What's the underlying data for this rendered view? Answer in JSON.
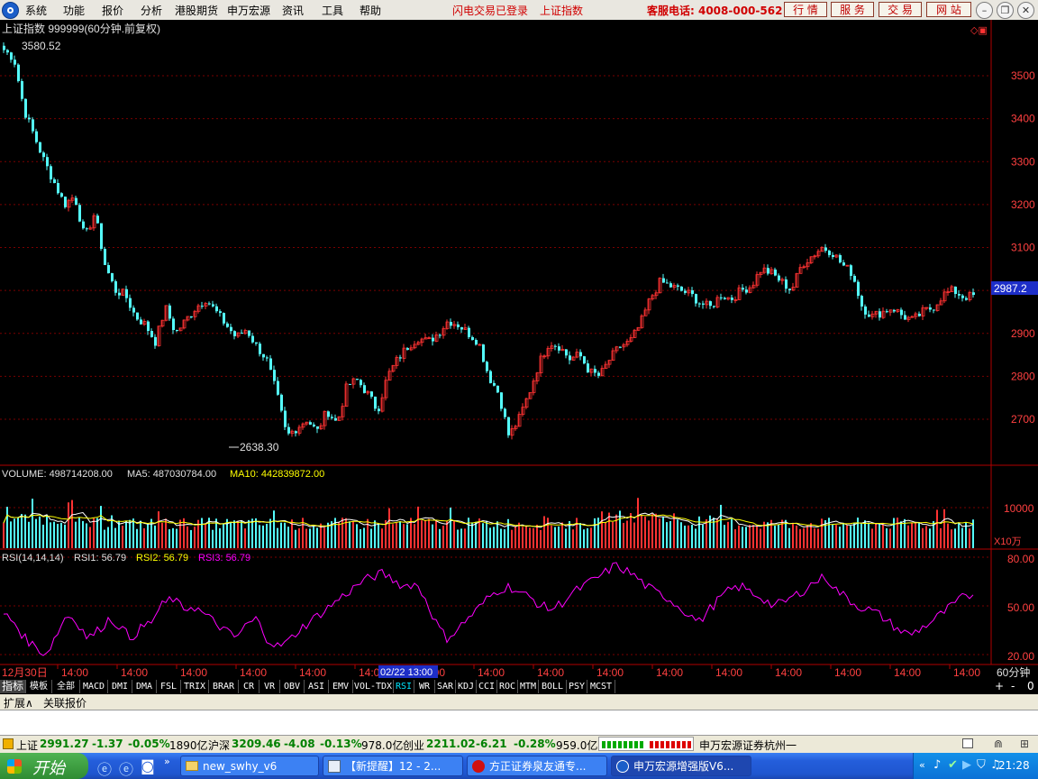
{
  "menu": {
    "items": [
      "系统",
      "功能",
      "报价",
      "分析",
      "港股期货",
      "申万宏源",
      "资讯",
      "工具",
      "帮助"
    ],
    "notice_login": "闪电交易已登录",
    "notice_index": "上证指数",
    "hotline": "客服电话: 4008-000-562",
    "buttons": [
      "行 情",
      "服 务",
      "交 易",
      "网 站"
    ]
  },
  "main_chart": {
    "title": "上证指数 999999(60分钟.前复权)",
    "high_label": "3580.52",
    "low_label": "2638.30",
    "current_price": "2987.2",
    "y_ticks": [
      "3500",
      "3400",
      "3300",
      "3200",
      "3100",
      "3000",
      "2900",
      "2800",
      "2700"
    ]
  },
  "volume_panel": {
    "title": "VOLUME: 498714208.00",
    "ma5": "MA5: 487030784.00",
    "ma10": "MA10: 442839872.00",
    "y_tick": "10000",
    "unit": "X10万"
  },
  "rsi_panel": {
    "title": "RSI(14,14,14)",
    "rsi1": "RSI1: 56.79",
    "rsi2": "RSI2: 56.79",
    "rsi3": "RSI3: 56.79",
    "y_ticks": [
      "80.00",
      "50.00",
      "20.00"
    ]
  },
  "time_axis": {
    "first_label": "12月30日",
    "labels": [
      "14:00",
      "14:00",
      "14:00",
      "14:00",
      "14:00",
      "14:00",
      "14:00",
      "14:00",
      "14:00",
      "14:00",
      "14:00",
      "14:00",
      "14:00",
      "14:00",
      "14:00",
      "14:00"
    ],
    "cursor_label": "02/22 13:00",
    "period": "60分钟"
  },
  "indicator_tabs": [
    "指标",
    "模板",
    "全部",
    "MACD",
    "DMI",
    "DMA",
    "FSL",
    "TRIX",
    "BRAR",
    "CR",
    "VR",
    "OBV",
    "ASI",
    "EMV",
    "VOL-TDX",
    "RSI",
    "WR",
    "SAR",
    "KDJ",
    "CCI",
    "ROC",
    "MTM",
    "BOLL",
    "PSY",
    "MCST"
  ],
  "indicator_active": "RSI",
  "tab_controls": [
    "+",
    "-",
    "0"
  ],
  "sub_tabs": [
    "扩展∧",
    "关联报价"
  ],
  "status": {
    "sh_label": "上证",
    "sh_value": "2991.27",
    "sh_change": "-1.37",
    "sh_pct": "-0.05%",
    "sh_amount": "1890亿",
    "hs_label": "沪深",
    "hs_value": "3209.46",
    "hs_change": "-4.08",
    "hs_pct": "-0.13%",
    "hs_amount": "978.0亿",
    "cy_label": "创业",
    "cy_value": "2211.02",
    "cy_change": "-6.21",
    "cy_pct": "-0.28%",
    "cy_amount": "959.0亿",
    "broker": "申万宏源证券杭州一"
  },
  "taskbar": {
    "start": "开始",
    "tasks": [
      "new_swhy_v6",
      "【新提醒】12 - 2...",
      "方正证券泉友通专...",
      "申万宏源增强版V6..."
    ],
    "clock": "21:28"
  },
  "colors": {
    "up": "#ff3232",
    "down": "#54fcfc",
    "ma5": "#ffffff",
    "ma10": "#ffff00",
    "rsi": "#ff00ff",
    "grid": "#7a0000",
    "axis": "#b00000"
  },
  "chart_data": [
    {
      "type": "candlestick",
      "title": "上证指数 999999(60分钟.前复权)",
      "ylim": [
        2620,
        3600
      ],
      "annotations": {
        "high": 3580.52,
        "low": 2638.3,
        "last": 2987.2
      },
      "close_path": [
        3560,
        3540,
        3420,
        3360,
        3300,
        3250,
        3200,
        3220,
        3120,
        3180,
        3060,
        3000,
        2990,
        2940,
        2920,
        2880,
        2960,
        2900,
        2930,
        2960,
        2980,
        2950,
        2920,
        2890,
        2910,
        2870,
        2840,
        2760,
        2660,
        2680,
        2700,
        2670,
        2720,
        2690,
        2780,
        2790,
        2760,
        2720,
        2800,
        2840,
        2870,
        2890,
        2880,
        2900,
        2930,
        2920,
        2900,
        2880,
        2800,
        2760,
        2660,
        2700,
        2760,
        2830,
        2880,
        2870,
        2840,
        2850,
        2810,
        2800,
        2840,
        2870,
        2880,
        2920,
        2980,
        3020,
        3010,
        3000,
        2990,
        2970,
        2960,
        2990,
        2980,
        3000,
        3010,
        3050,
        3040,
        3020,
        3000,
        3060,
        3080,
        3100,
        3090,
        3060,
        3040,
        2960,
        2940,
        2950,
        2960,
        2940,
        2930,
        2950,
        2960,
        2990,
        3000,
        2985,
        2987
      ]
    },
    {
      "type": "bar",
      "title": "VOLUME",
      "series": [
        {
          "name": "VOLUME",
          "last": 498714208
        },
        {
          "name": "MA5",
          "last": 487030784
        },
        {
          "name": "MA10",
          "last": 442839872
        }
      ]
    },
    {
      "type": "line",
      "title": "RSI(14,14,14)",
      "ylim": [
        15,
        85
      ],
      "series": [
        {
          "name": "RSI1",
          "values": [
            45,
            40,
            30,
            25,
            20,
            32,
            45,
            40,
            30,
            35,
            42,
            38,
            30,
            36,
            40,
            50,
            55,
            48,
            50,
            45,
            40,
            35,
            30,
            38,
            42,
            30,
            25,
            28,
            35,
            40,
            45,
            50,
            55,
            60,
            65,
            68,
            70,
            66,
            62,
            64,
            55,
            40,
            30,
            35,
            42,
            48,
            55,
            60,
            62,
            58,
            55,
            50,
            48,
            52,
            58,
            62,
            66,
            70,
            75,
            72,
            68,
            62,
            58,
            55,
            50,
            45,
            40,
            48,
            55,
            60,
            62,
            58,
            55,
            50,
            52,
            56,
            60,
            65,
            68,
            60,
            55,
            50,
            48,
            45,
            40,
            35,
            32,
            36,
            40,
            45,
            50,
            55,
            57
          ]
        }
      ]
    }
  ]
}
